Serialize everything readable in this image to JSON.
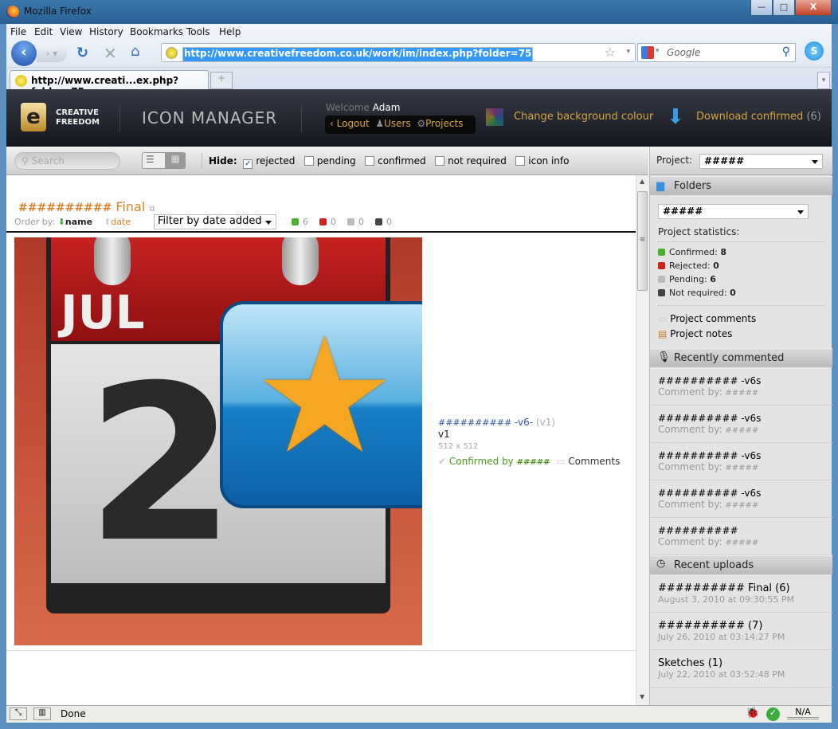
{
  "window": {
    "title": "Mozilla Firefox",
    "minimize": "—",
    "maximize": "□",
    "close": "X"
  },
  "menu": [
    "File",
    "Edit",
    "View",
    "History",
    "Bookmarks",
    "Tools",
    "Help"
  ],
  "nav": {
    "url": "http://www.creativefreedom.co.uk/work/im/index.php?folder=75",
    "search_placeholder": "Google"
  },
  "tabs": [
    {
      "label": "http://www.creati...ex.php?folder=75"
    }
  ],
  "new_tab": "+",
  "header": {
    "logo_line1": "CREATIVE",
    "logo_line2": "FREEDOM",
    "app_title": "ICON MANAGER",
    "welcome": "Welcome",
    "user": "Adam",
    "logout": "Logout",
    "users": "Users",
    "projects": "Projects",
    "change_bg": "Change background colour",
    "download": "Download confirmed",
    "download_count": "(6)"
  },
  "toolbar": {
    "search_placeholder": "Search",
    "hide_label": "Hide:",
    "filters": [
      {
        "label": "rejected",
        "checked": true
      },
      {
        "label": "pending",
        "checked": false
      },
      {
        "label": "confirmed",
        "checked": false
      },
      {
        "label": "not required",
        "checked": false
      },
      {
        "label": "icon info",
        "checked": false
      }
    ]
  },
  "folder": {
    "title_hash": "##########",
    "title": "Final",
    "order_by": "Order by:",
    "order_name": "name",
    "order_date": "date",
    "filter_select": "Filter by date added",
    "counts": [
      {
        "color": "#4caf30",
        "value": "6"
      },
      {
        "color": "#d02020",
        "value": "0"
      },
      {
        "color": "#bbbbbb",
        "value": "0"
      },
      {
        "color": "#444444",
        "value": "0"
      }
    ]
  },
  "icon": {
    "month": "JUL",
    "day": "2",
    "name_hash": "##########",
    "name_suffix": "-v6-",
    "version_paren": "(v1)",
    "version": "v1",
    "size": "512 x 512",
    "confirmed_by": "Confirmed by",
    "confirmer": "#####",
    "comments": "Comments"
  },
  "sidebar": {
    "project_label": "Project:",
    "project_value": "#####",
    "folders_title": "Folders",
    "folder_value": "#####",
    "stats_title": "Project statistics:",
    "stats": [
      {
        "label": "Confirmed:",
        "value": "8",
        "color": "#4caf30"
      },
      {
        "label": "Rejected:",
        "value": "0",
        "color": "#d02020"
      },
      {
        "label": "Pending:",
        "value": "6",
        "color": "#bbbbbb"
      },
      {
        "label": "Not required:",
        "value": "0",
        "color": "#444444"
      }
    ],
    "project_comments": "Project comments",
    "project_notes": "Project notes",
    "recent_commented_title": "Recently commented",
    "recent_commented": [
      {
        "name": "########## -v6s",
        "by": "Comment by:",
        "user": "#####"
      },
      {
        "name": "########## -v6s",
        "by": "Comment by:",
        "user": "#####"
      },
      {
        "name": "########## -v6s",
        "by": "Comment by:",
        "user": "#####"
      },
      {
        "name": "########## -v6s",
        "by": "Comment by:",
        "user": "#####"
      },
      {
        "name": "##########",
        "by": "Comment by:",
        "user": "#####"
      }
    ],
    "recent_uploads_title": "Recent uploads",
    "recent_uploads": [
      {
        "name": "##########  Final (6)",
        "date": "August 3, 2010 at 09:30:55 PM"
      },
      {
        "name": "##########  (7)",
        "date": "July 26, 2010 at 03:14:27 PM"
      },
      {
        "name": "Sketches (1)",
        "date": "July 22, 2010 at 03:52:48 PM"
      }
    ]
  },
  "status": {
    "text": "Done",
    "right": "N/A"
  }
}
